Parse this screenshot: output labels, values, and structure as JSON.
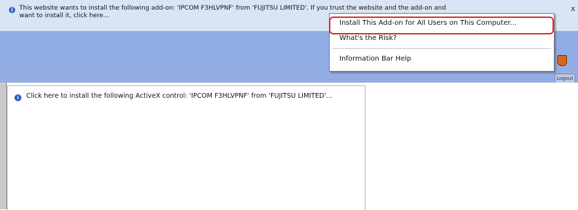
{
  "infobar": {
    "text_line1": "This website wants to install the following add-on: 'IPCOM F3HLVPNF' from 'FUJITSU LIMITED'. If you trust the website and the add-on and",
    "text_line2": "want to install it, click here...",
    "close_glyph": "x"
  },
  "toolbar": {
    "logout_label": "Logout"
  },
  "pane": {
    "message": "Click here to install the following ActiveX control: 'IPCOM F3HLVPNF' from 'FUJITSU LIMITED'..."
  },
  "context_menu": {
    "items": [
      {
        "label": "Install This Add-on for All Users on This Computer..."
      },
      {
        "label": "What's the Risk?"
      },
      {
        "label": "Information Bar Help"
      }
    ]
  },
  "colors": {
    "infobar_bg": "#d9e4f4",
    "band": "#8aa6e0",
    "highlight": "#e0262b"
  }
}
